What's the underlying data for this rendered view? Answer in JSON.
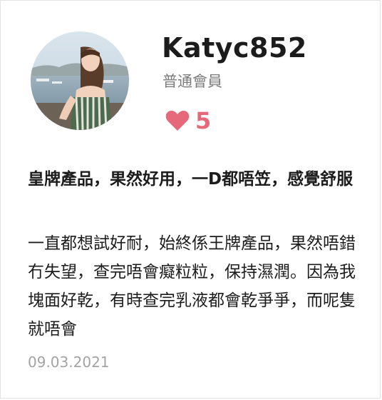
{
  "user": {
    "name": "Katyc852",
    "member_level": "普通會員",
    "likes": "5"
  },
  "review": {
    "title": "皇牌產品，果然好用，一D都唔笠，感覺舒服",
    "body": "一直都想試好耐，始終係王牌產品，果然唔錯冇失望，查完唔會癡粒粒，保持濕潤。因為我塊面好乾，有時查完乳液都會乾爭爭，而呢隻就唔會",
    "date": "09.03.2021"
  },
  "icons": {
    "likes": "heart-icon"
  },
  "colors": {
    "heart": "#e5697a",
    "muted_text": "#7b7b7b",
    "date_text": "#a3a3a3"
  }
}
